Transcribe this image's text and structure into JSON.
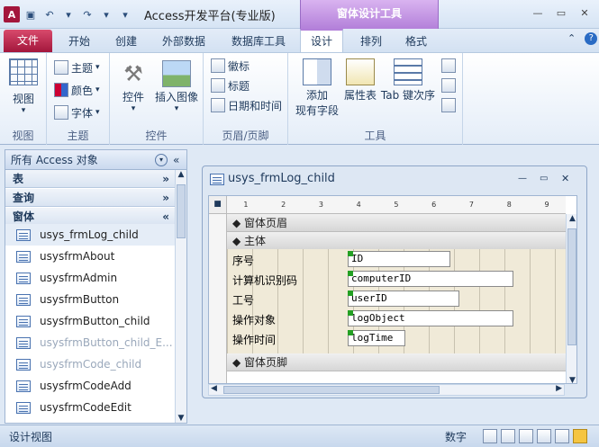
{
  "titlebar": {
    "app_title": "Access开发平台(专业版)",
    "context_tools_label": "窗体设计工具"
  },
  "tabs": {
    "file": "文件",
    "items": [
      "开始",
      "创建",
      "外部数据",
      "数据库工具",
      "设计",
      "排列",
      "格式"
    ]
  },
  "ribbon": {
    "groups": {
      "view": {
        "label": "视图",
        "view_button": "视图"
      },
      "theme": {
        "label": "主题",
        "theme": "主题",
        "colors": "颜色",
        "fonts": "字体"
      },
      "controls": {
        "label": "控件",
        "controls_button": "控件",
        "insert_image": "插入图像"
      },
      "header_footer": {
        "label": "页眉/页脚",
        "logo": "徽标",
        "title": "标题",
        "datetime": "日期和时间"
      },
      "tools": {
        "label": "工具",
        "add_fields_line1": "添加",
        "add_fields_line2": "现有字段",
        "property_sheet": "属性表",
        "tab_order": "Tab 键次序"
      }
    }
  },
  "nav": {
    "header": "所有 Access 对象",
    "sections": {
      "tables": "表",
      "queries": "查询",
      "forms": "窗体"
    },
    "items": [
      {
        "label": "usys_frmLog_child"
      },
      {
        "label": "usysfrmAbout"
      },
      {
        "label": "usysfrmAdmin"
      },
      {
        "label": "usysfrmButton"
      },
      {
        "label": "usysfrmButton_child"
      },
      {
        "label": "usysfrmButton_child_E..."
      },
      {
        "label": "usysfrmCode_child"
      },
      {
        "label": "usysfrmCodeAdd"
      },
      {
        "label": "usysfrmCodeEdit"
      }
    ]
  },
  "document": {
    "title": "usys_frmLog_child",
    "sections": {
      "header": "窗体页眉",
      "detail": "主体",
      "footer": "窗体页脚"
    },
    "fields": [
      {
        "label": "序号",
        "control": "ID"
      },
      {
        "label": "计算机识别码",
        "control": "computerID"
      },
      {
        "label": "工号",
        "control": "userID"
      },
      {
        "label": "操作对象",
        "control": "logObject"
      },
      {
        "label": "操作时间",
        "control": "logTime"
      }
    ],
    "ruler": [
      "1",
      "2",
      "3",
      "4",
      "5",
      "6",
      "7",
      "8",
      "9"
    ]
  },
  "status": {
    "left": "设计视图",
    "numlock": "数字"
  }
}
